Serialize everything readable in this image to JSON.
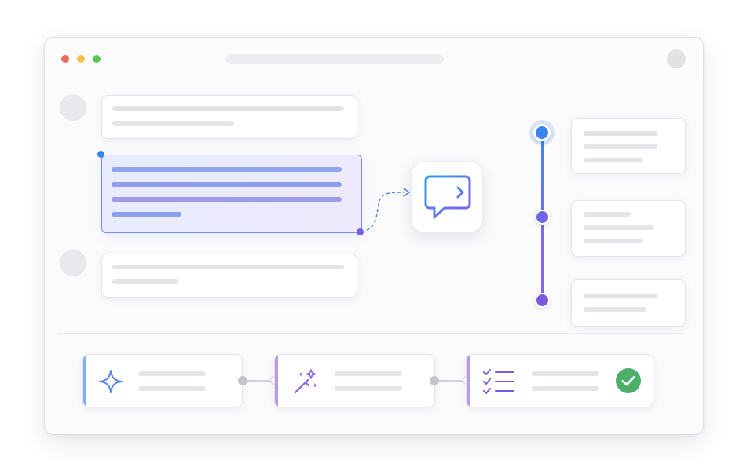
{
  "window": {
    "traffic_lights": [
      "#ec6a5e",
      "#f4bf4f",
      "#61c554"
    ]
  },
  "icons": {
    "chat": "message-square-text-icon",
    "sparkle": "sparkle-icon",
    "wand": "magic-wand-icon",
    "checklist": "checklist-icon",
    "done": "check-circle-icon"
  },
  "colors": {
    "accent_blue": "#3a86f0",
    "accent_purple": "#7a5ae0",
    "success": "#4caf6a"
  }
}
